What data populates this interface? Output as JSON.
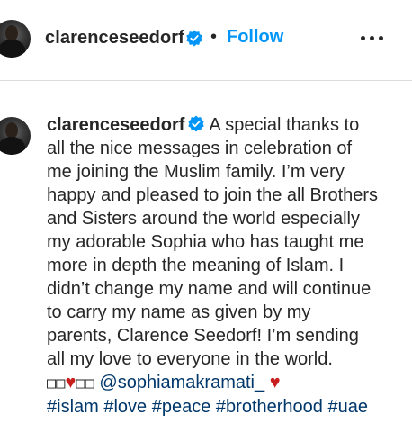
{
  "header": {
    "username": "clarenceseedorf",
    "separator": "•",
    "follow_label": "Follow"
  },
  "post": {
    "username": "clarenceseedorf",
    "caption_text": "A special thanks to all the nice messages in celebration of me joining the Muslim family. I’m very happy and pleased to join the all Brothers and Sisters around the world especially my adorable Sophia who has taught me more in depth the meaning of Islam. I didn’t change my name and will continue to carry my name as given by my parents, Clarence Seedorf! I’m sending all my love to everyone in the world.",
    "emoji_left": "□□",
    "heart": "♥",
    "emoji_right": "□□",
    "mention": "@sophiamakramati_",
    "hashtags": [
      "#islam",
      "#love",
      "#peace",
      "#brotherhood",
      "#uae"
    ]
  },
  "colors": {
    "follow_blue": "#0095f6",
    "link_dark_blue": "#00376b",
    "verified_blue": "#0095f6",
    "heart_red": "#c81e1e"
  },
  "icons": {
    "verified": "verified-badge-icon",
    "more": "more-options-icon"
  }
}
